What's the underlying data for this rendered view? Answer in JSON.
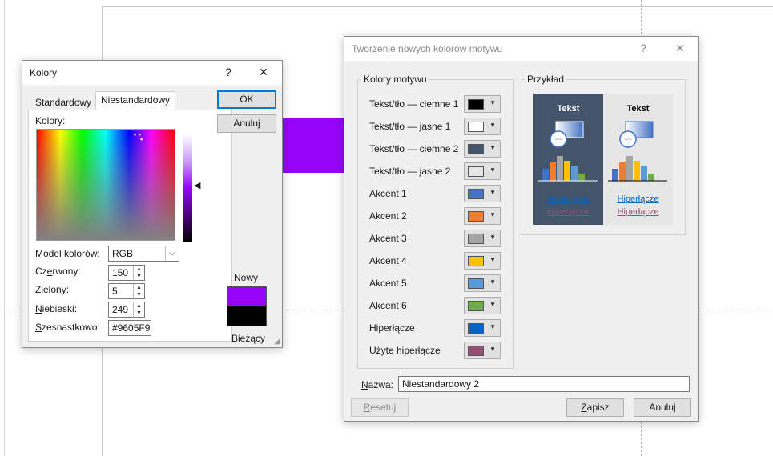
{
  "colors_dialog": {
    "title": "Kolory",
    "help_symbol": "?",
    "close_symbol": "✕",
    "tabs": [
      "Standardowy",
      "Niestandardowy"
    ],
    "active_tab": "Niestandardowy",
    "colors_label": "Kolory:",
    "model_label": "Model kolorów:",
    "model_value": "RGB",
    "red_label": "Czerwony:",
    "red_value": "150",
    "green_label": "Zielony:",
    "green_value": "5",
    "blue_label": "Niebieski:",
    "blue_value": "249",
    "hex_label": "Szesnastkowo:",
    "hex_value": "#9605F9",
    "ok_label": "OK",
    "cancel_label": "Anuluj",
    "new_label": "Nowy",
    "current_label": "Bieżący",
    "new_color": "#9605F9",
    "current_color": "#000000"
  },
  "theme_dialog": {
    "title": "Tworzenie nowych kolorów motywu",
    "help_symbol": "?",
    "close_symbol": "✕",
    "theme_colors_group": "Kolory motywu",
    "preview_group": "Przykład",
    "items": [
      {
        "label": "Tekst/tło — ciemne 1",
        "color": "#000000"
      },
      {
        "label": "Tekst/tło — jasne 1",
        "color": "#FFFFFF"
      },
      {
        "label": "Tekst/tło — ciemne 2",
        "color": "#44546A"
      },
      {
        "label": "Tekst/tło — jasne 2",
        "color": "#E7E6E6"
      },
      {
        "label": "Akcent 1",
        "color": "#4472C4"
      },
      {
        "label": "Akcent 2",
        "color": "#ED7D31"
      },
      {
        "label": "Akcent 3",
        "color": "#A5A5A5"
      },
      {
        "label": "Akcent 4",
        "color": "#FFC000"
      },
      {
        "label": "Akcent 5",
        "color": "#5B9BD5"
      },
      {
        "label": "Akcent 6",
        "color": "#70AD47"
      },
      {
        "label": "Hiperłącze",
        "color": "#0563C1"
      },
      {
        "label": "Użyte hiperłącze",
        "color": "#954F72"
      }
    ],
    "preview": {
      "text_label": "Tekst",
      "hyperlink_label": "Hiperłącze",
      "followed_label": "Hiperłącze"
    },
    "name_label": "Nazwa:",
    "name_value": "Niestandardowy 2",
    "reset_label": "Resetuj",
    "save_label": "Zapisz",
    "cancel_label": "Anuluj"
  },
  "slide": {
    "shape_color": "#9605F9"
  }
}
